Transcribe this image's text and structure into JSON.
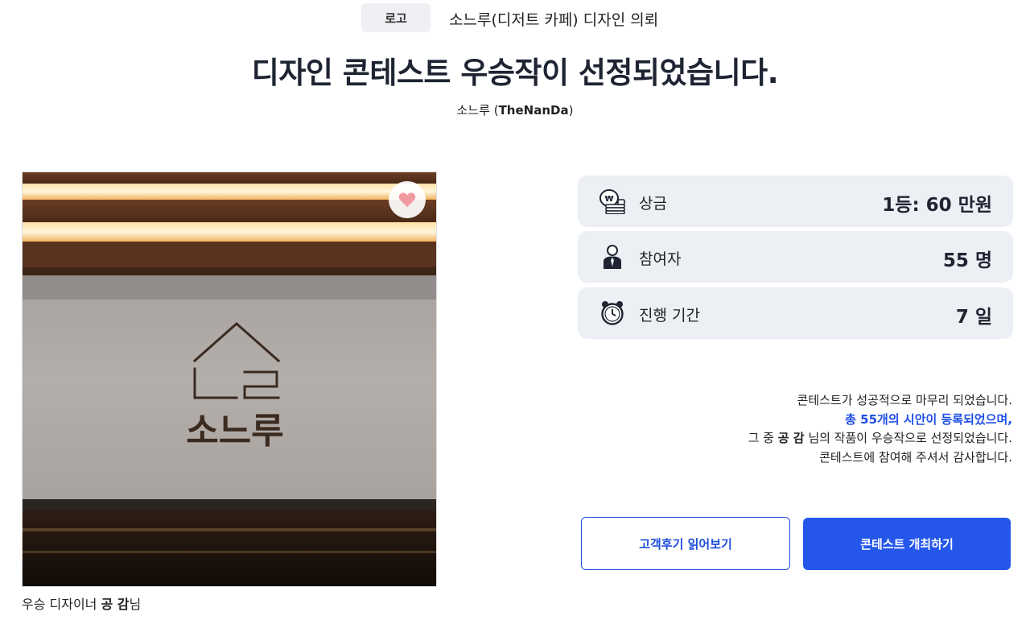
{
  "header": {
    "category_badge": "로고",
    "request_title": "소느루(디저트 카페) 디자인 의뢰"
  },
  "page_title": "디자인 콘테스트 우승작이 선정되었습니다.",
  "client": {
    "name": "소느루",
    "brand_open": " (",
    "brand": "TheNanDa",
    "brand_close": ")"
  },
  "winner": {
    "logo_text": "소느루",
    "caption_prefix": "우승 디자이너 ",
    "designer": "공 감",
    "caption_suffix": "님"
  },
  "stats": [
    {
      "icon": "money-icon",
      "label": "상금",
      "value": "1등: 60 만원"
    },
    {
      "icon": "person-icon",
      "label": "참여자",
      "value": "55 명"
    },
    {
      "icon": "alarm-clock-icon",
      "label": "진행 기간",
      "value": "7 일"
    }
  ],
  "summary": {
    "line1": "콘테스트가 성공적으로 마무리 되었습니다.",
    "line2": "총 55개의 시안이 등록되었으며,",
    "line3_prefix": "그 중 ",
    "line3_name": "공 감",
    "line3_suffix": " 님의 작품이 우승작으로 선정되었습니다.",
    "line4": "콘테스트에 참여해 주셔서 감사합니다."
  },
  "buttons": {
    "review": "고객후기 읽어보기",
    "host": "콘테스트 개최하기"
  },
  "colors": {
    "accent": "#2456ea",
    "highlight_text": "#1e4ee8",
    "card_bg": "#eceff3",
    "like_heart": "#f19a9f"
  }
}
